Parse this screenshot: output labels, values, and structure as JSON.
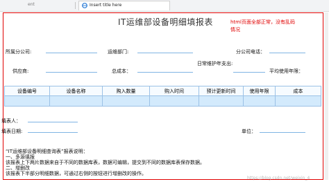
{
  "tabs": {
    "previous_label": "ent",
    "active_label": "Insert title here"
  },
  "page": {
    "title": "IT运维部设备明细填报表",
    "note": "html页面全部正常，没有乱码情况"
  },
  "form": {
    "company_label": "所属分公司:",
    "dept_label": "运维部门:",
    "phone_label": "分公司电话：",
    "supplier_label": "供应商:",
    "total_label": "总成本：",
    "maint_label": "日常维护年支出:",
    "avg_years_label": "平均使用年限："
  },
  "table": {
    "headers": [
      "设备编号",
      "设备名称",
      "购入数量",
      "购入时间",
      "预计更新时间",
      "使用年限",
      "成本"
    ]
  },
  "footer": {
    "person_label": "填表人：",
    "date_label": "填表日期:",
    "unit_label": "单位：",
    "explanation": [
      "“IT运维部设备明细查询表”报表说明：",
      "一、多源填报",
      "该报表上下两片数据来自于不同的数据库表，数据可编辑，提交到不同的数据库表保存数据。",
      "二、增删改",
      "该报表下半部分明细数据，可通过右侧的按钮进行增删改的操作。"
    ]
  },
  "watermark": "https://blog.csdn.net/weixin_4"
}
